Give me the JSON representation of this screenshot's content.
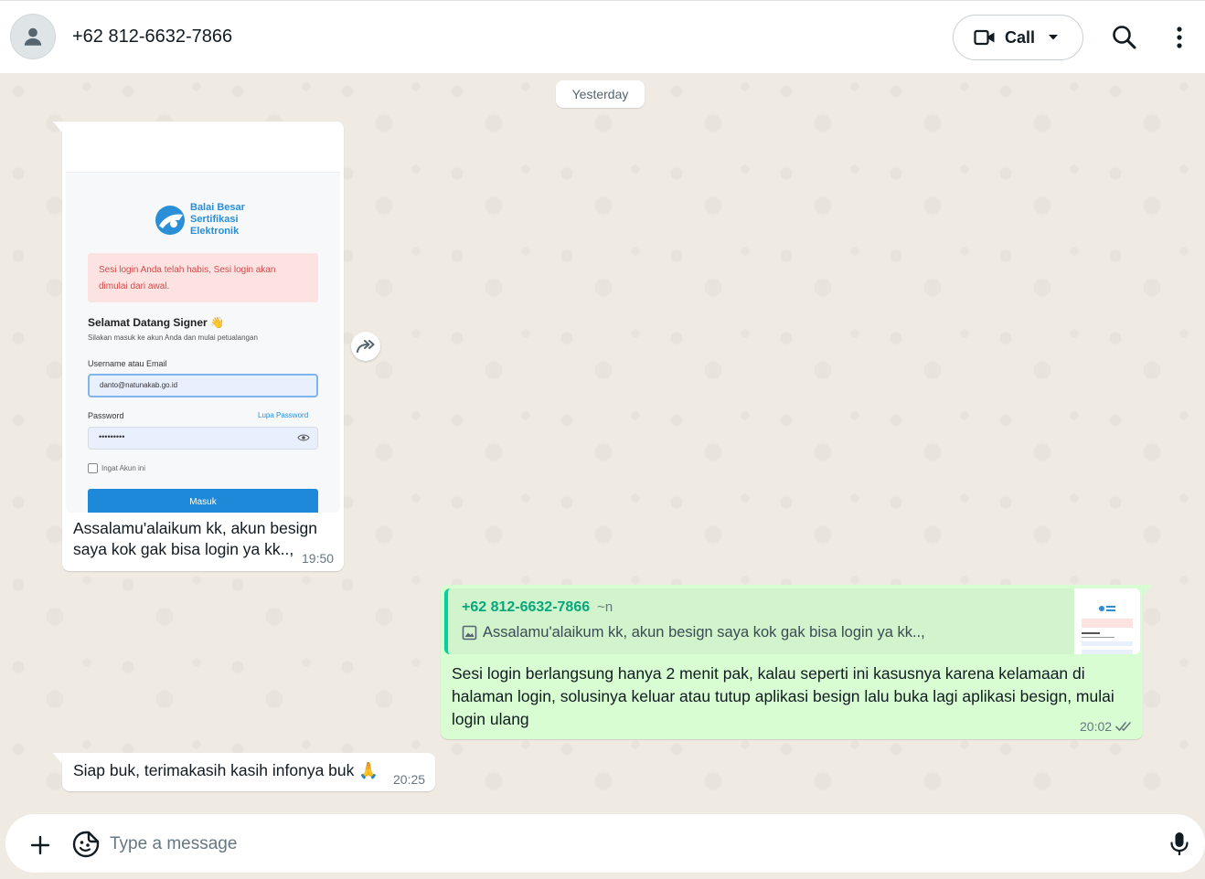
{
  "header": {
    "contact_name": "+62 812-6632-7866",
    "call_label": "Call"
  },
  "chat": {
    "date_divider": "Yesterday",
    "messages": [
      {
        "direction": "incoming",
        "type": "image",
        "image": {
          "logo_lines": [
            "Balai Besar",
            "Sertifikasi",
            "Elektronik"
          ],
          "alert_line1": "Sesi login Anda telah habis, Sesi login akan",
          "alert_line2": "dimulai dari awal.",
          "welcome": "Selamat Datang Signer 👋",
          "subtitle": "Silakan masuk ke akun Anda dan mulai petualangan",
          "username_label": "Username atau Email",
          "username_value": "danto@natunakab.go.id",
          "password_label": "Password",
          "forgot_label": "Lupa Password",
          "password_value": "•••••••••",
          "remember_label": "Ingat Akun ini",
          "submit_label": "Masuk"
        },
        "caption": "Assalamu'alaikum kk, akun besign saya kok gak bisa login ya kk..,",
        "time": "19:50"
      },
      {
        "direction": "outgoing",
        "type": "reply",
        "quote_author": "+62 812-6632-7866",
        "quote_pushname": "~n",
        "quote_text": "Assalamu'alaikum kk, akun besign saya kok gak bisa login ya kk..,",
        "text": "Sesi login berlangsung hanya 2 menit pak, kalau seperti ini kasusnya karena kelamaan di halaman login, solusinya keluar atau tutup aplikasi besign lalu buka lagi aplikasi besign, mulai login ulang",
        "time": "20:02",
        "status": "read"
      },
      {
        "direction": "incoming",
        "type": "text",
        "text": "Siap buk, terimakasih kasih infonya buk 🙏",
        "time": "20:25"
      }
    ]
  },
  "composer": {
    "placeholder": "Type a message"
  },
  "icons": {
    "avatar": "person-icon",
    "call": "video-camera-icon",
    "search": "search-icon",
    "menu": "kebab-menu-icon",
    "forward": "forward-icon",
    "attach": "plus-icon",
    "sticker": "sticker-icon",
    "mic": "microphone-icon",
    "read": "double-check-icon",
    "image": "image-icon"
  },
  "colors": {
    "accent": "#06cf9c",
    "outgoing_bubble": "#d9fdd3",
    "incoming_bubble": "#ffffff",
    "chat_background": "#efeae2",
    "read_tick": "#667781"
  }
}
